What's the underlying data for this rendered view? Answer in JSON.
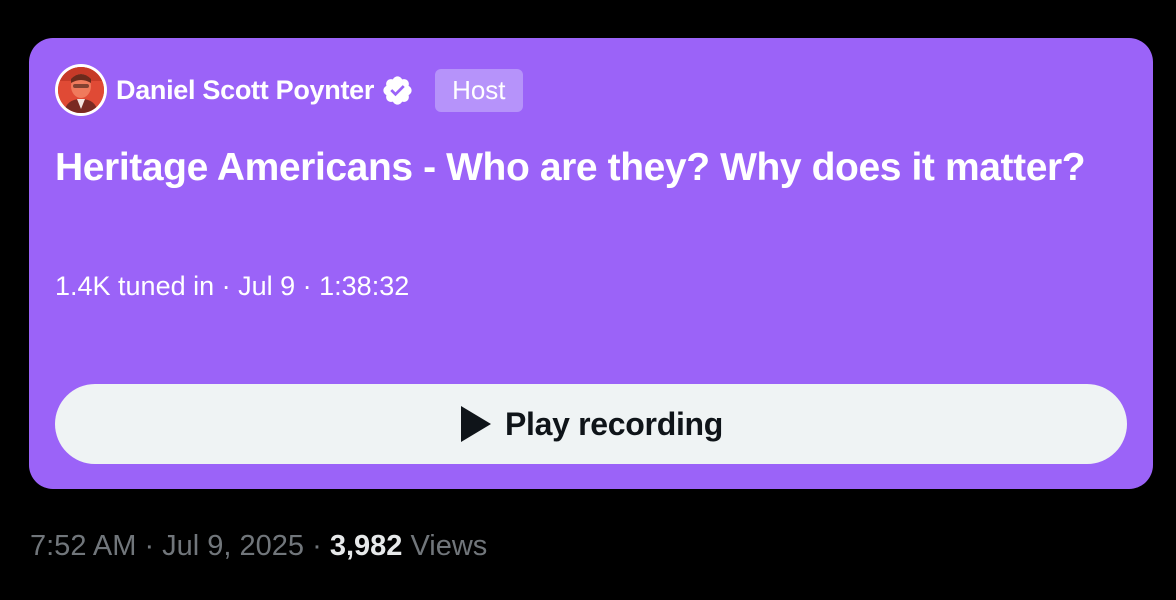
{
  "space": {
    "host_name": "Daniel Scott Poynter",
    "host_badge": "Host",
    "title": "Heritage Americans - Who are they? Why does it matter?",
    "meta": "1.4K tuned in · Jul 9 · 1:38:32",
    "play_label": "Play recording",
    "card_color": "#9B63F8",
    "badge_color": "#B693FA",
    "play_icon": "play-icon",
    "verified_icon": "verified-badge-icon",
    "host_avatar": "host-avatar"
  },
  "footer": {
    "timestamp": "7:52 AM · Jul 9, 2025 · ",
    "views_count": "3,982",
    "views_label": " Views"
  }
}
